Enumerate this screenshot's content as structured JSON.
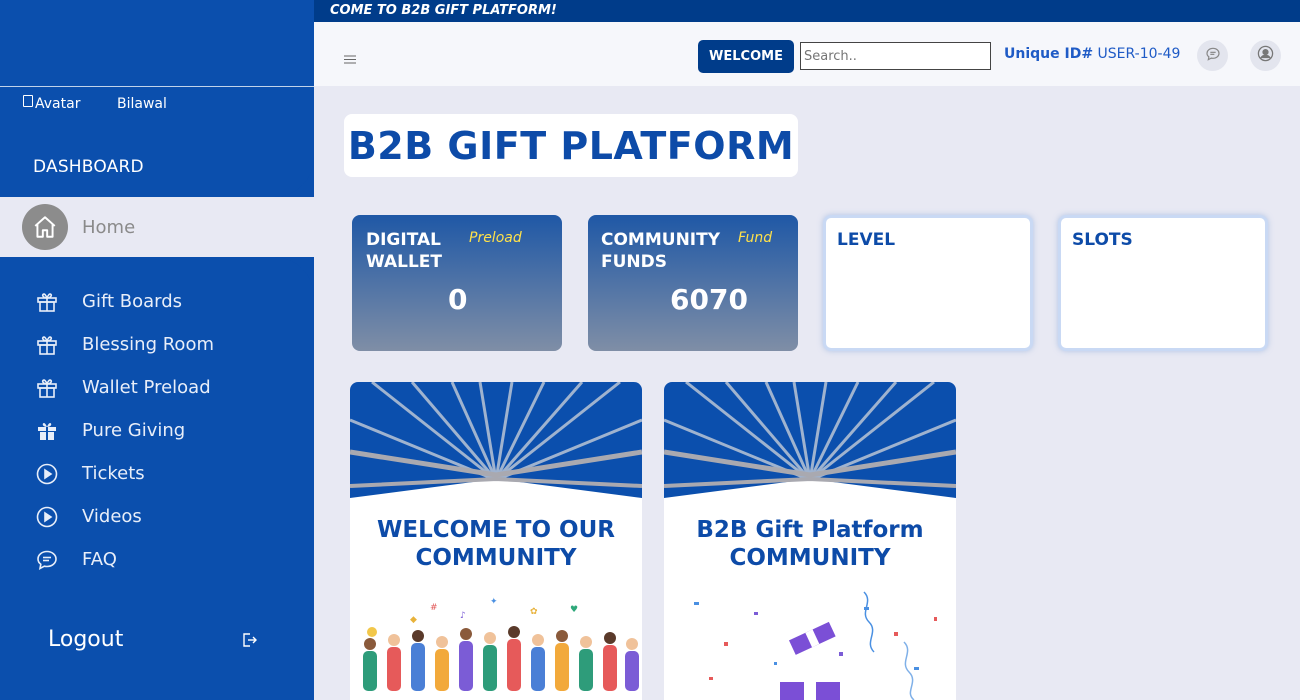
{
  "marquee": "COME TO B2B GIFT PLATFORM!",
  "sidebar": {
    "avatar_alt": "Avatar",
    "username": "Bilawal",
    "section": "DASHBOARD",
    "active_item": "Home",
    "items": [
      {
        "label": "Gift Boards",
        "icon": "gift-outline-icon"
      },
      {
        "label": "Blessing Room",
        "icon": "gift-outline-icon"
      },
      {
        "label": "Wallet Preload",
        "icon": "gift-outline-icon"
      },
      {
        "label": "Pure Giving",
        "icon": "gift-solid-icon"
      },
      {
        "label": "Tickets",
        "icon": "play-circle-icon"
      },
      {
        "label": "Videos",
        "icon": "play-circle-icon"
      },
      {
        "label": "FAQ",
        "icon": "chat-icon"
      }
    ],
    "logout": "Logout"
  },
  "header": {
    "welcome": "WELCOME",
    "search_placeholder": "Search..",
    "uid_label": "Unique ID#",
    "uid_value": "USER-10-49"
  },
  "main": {
    "title": "B2B GIFT PLATFORM",
    "stats": [
      {
        "line1": "DIGITAL",
        "line2": "WALLET",
        "tag": "Preload",
        "value": "0"
      },
      {
        "line1": "COMMUNITY",
        "line2": "FUNDS",
        "tag": "Fund",
        "value": "6070"
      },
      {
        "line1": "LEVEL"
      },
      {
        "line1": "SLOTS"
      }
    ],
    "cards": [
      {
        "line1": "WELCOME TO OUR",
        "line2": "COMMUNITY"
      },
      {
        "line1": "B2B Gift Platform",
        "line2": "COMMUNITY"
      }
    ]
  },
  "colors": {
    "sidebar": "#0b4fad",
    "accent": "#003c8a",
    "title": "#0d4ba8",
    "tag": "#ffe14a"
  }
}
